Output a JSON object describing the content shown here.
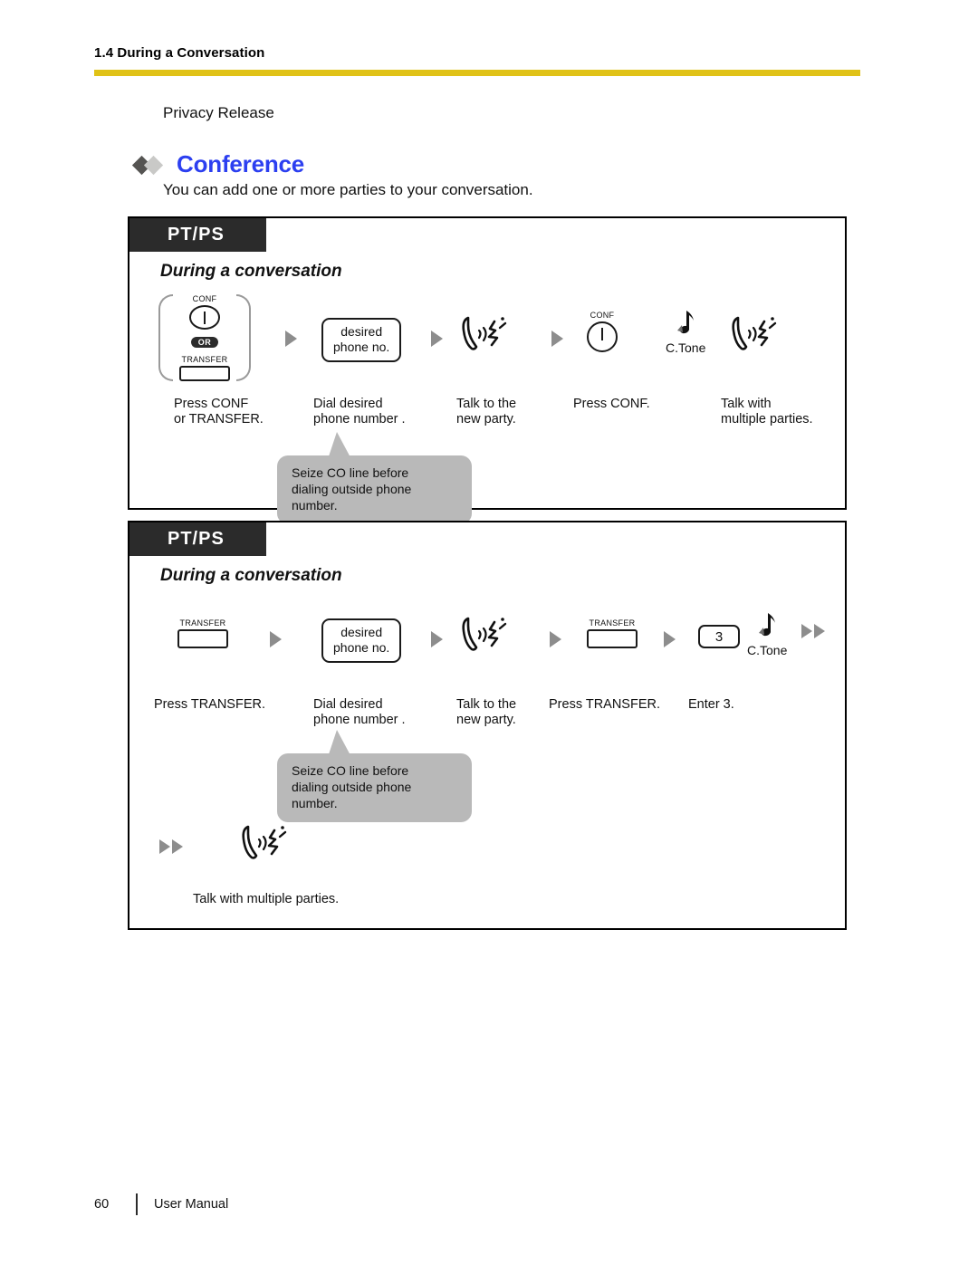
{
  "header": {
    "title": "1.4 During a Conversation",
    "rule_color": "#e0c217"
  },
  "section": {
    "previous_topic": "Privacy Release",
    "heading": "Conference",
    "heading_color": "#2c3ff0",
    "intro": "You can add one or more parties to your conversation.",
    "bullet_dark": "#555452",
    "bullet_light": "#c9c9c7"
  },
  "procedures": [
    {
      "badge": "PT/PS",
      "context": "During a conversation",
      "steps": [
        {
          "icon": "conf-or-transfer-button-group",
          "conf_label": "CONF",
          "or_label": "OR",
          "transfer_label": "TRANSFER",
          "caption": "Press CONF\nor TRANSFER."
        },
        {
          "icon": "dial-box",
          "box_text": "desired\nphone  no.",
          "caption": "Dial desired\nphone number  ."
        },
        {
          "icon": "talk-icon",
          "caption": "Talk to the\nnew party."
        },
        {
          "icon": "conf-button",
          "conf_label": "CONF",
          "caption": "Press CONF."
        },
        {
          "icon": "ctone-and-talk",
          "ctone_label": "C.Tone",
          "caption": "Talk with\nmultiple parties."
        }
      ],
      "bubble": "Seize CO line before\ndialing outside phone number."
    },
    {
      "badge": "PT/PS",
      "context": "During a conversation",
      "steps": [
        {
          "icon": "transfer-button",
          "transfer_label": "TRANSFER",
          "caption": "Press TRANSFER."
        },
        {
          "icon": "dial-box",
          "box_text": "desired\nphone  no.",
          "caption": "Dial desired\nphone number  ."
        },
        {
          "icon": "talk-icon",
          "caption": "Talk to the\nnew party."
        },
        {
          "icon": "transfer-button",
          "transfer_label": "TRANSFER",
          "caption": "Press TRANSFER."
        },
        {
          "icon": "key-and-ctone",
          "key_label": "3",
          "ctone_label": "C.Tone",
          "caption": "Enter 3."
        },
        {
          "icon": "talk-icon",
          "caption": "Talk with multiple parties."
        }
      ],
      "bubble": "Seize CO line before\ndialing outside phone number."
    }
  ],
  "footer": {
    "page_number": "60",
    "document_name": "User Manual"
  }
}
